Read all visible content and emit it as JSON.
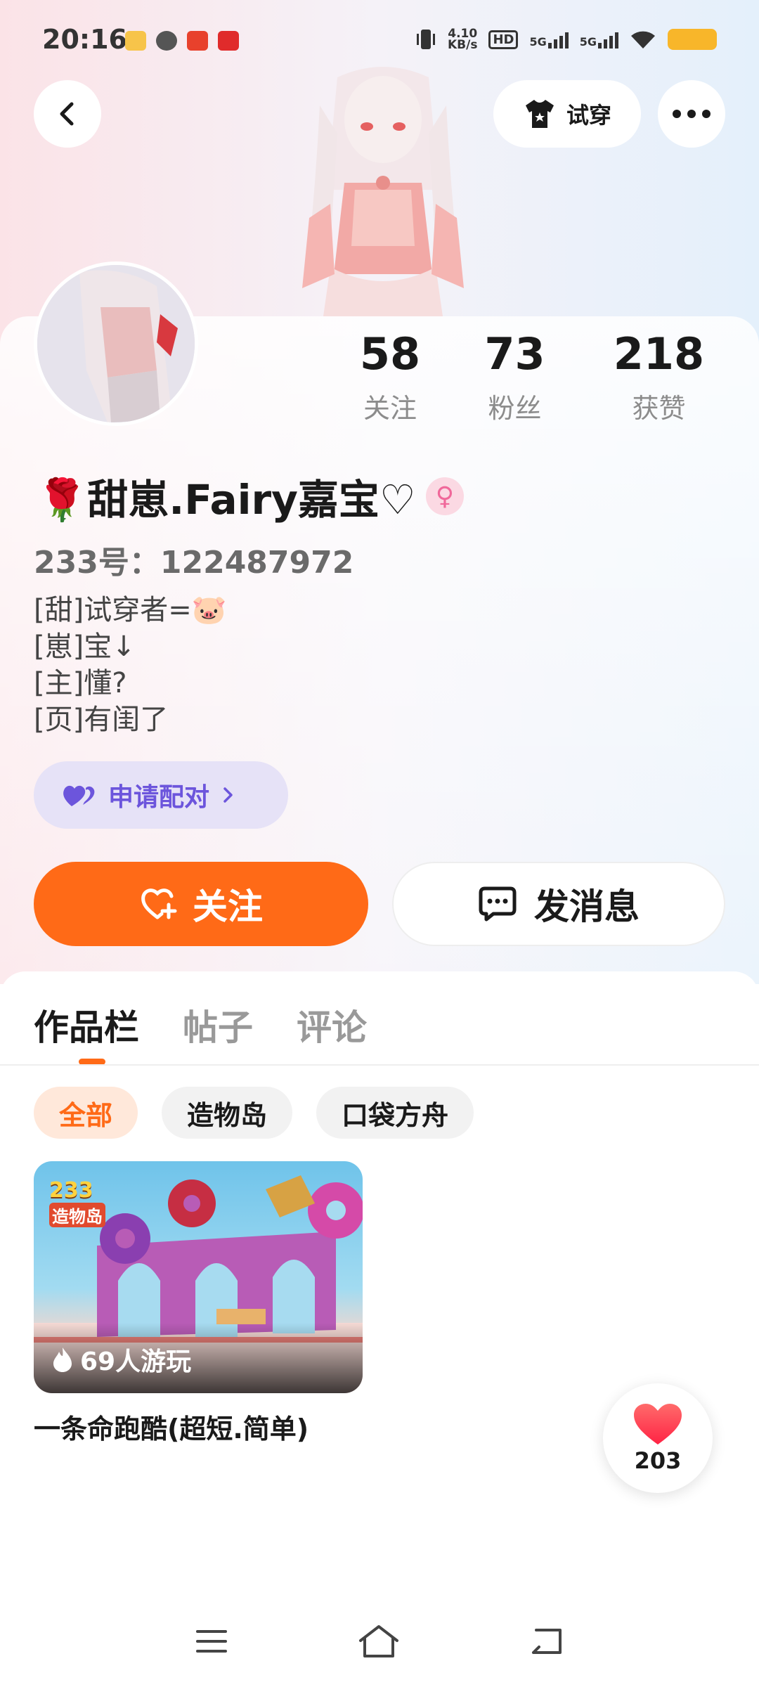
{
  "status_bar": {
    "time": "20:16",
    "net_speed_top": "4.10",
    "net_speed_bottom": "KB/s",
    "hd_label": "HD",
    "sig1_label": "5G",
    "sig2_label": "5G",
    "battery_color": "#f8b62a"
  },
  "header": {
    "tryon_label": "试穿"
  },
  "profile": {
    "stats": [
      {
        "value": "58",
        "label": "关注"
      },
      {
        "value": "73",
        "label": "粉丝"
      },
      {
        "value": "218",
        "label": "获赞"
      }
    ],
    "name": "🌹甜崽.Fairy嘉宝♡",
    "gender_symbol": "♀",
    "uid": "233号：122487972",
    "bio": [
      "[甜]试穿者=🐷",
      "[崽]宝↓",
      "[主]懂?",
      "[页]有闺了"
    ],
    "pair_label": "申请配对",
    "follow_label": "关注",
    "message_label": "发消息"
  },
  "tabs": {
    "items": [
      "作品栏",
      "帖子",
      "评论"
    ],
    "active": 0
  },
  "filters": {
    "items": [
      "全部",
      "造物岛",
      "口袋方舟"
    ],
    "active": 0
  },
  "works": [
    {
      "badge_top": "233",
      "badge_bottom": "造物岛",
      "plays": "69人游玩",
      "title": "一条命跑酷(超短.简单)"
    }
  ],
  "like_fab": {
    "count": "203"
  },
  "colors": {
    "accent": "#ff6a17",
    "pair_purple": "#6c55dc",
    "like_red": "#ff3b4e"
  }
}
